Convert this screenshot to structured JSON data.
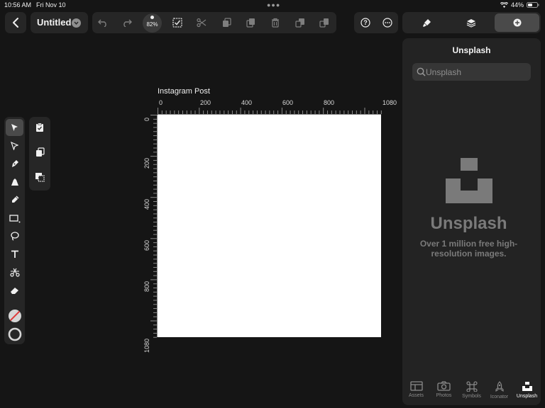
{
  "status_bar": {
    "time": "10:56 AM",
    "date": "Fri Nov 10",
    "battery": "44%"
  },
  "document": {
    "title": "Untitled",
    "zoom": "82%"
  },
  "artboard": {
    "title": "Instagram Post",
    "h_ticks": [
      "0",
      "200",
      "400",
      "600",
      "800",
      "1080"
    ],
    "v_ticks": [
      "0",
      "200",
      "400",
      "600",
      "800",
      "1080"
    ]
  },
  "panel": {
    "title": "Unsplash",
    "search_placeholder": "Unsplash",
    "brand": "Unsplash",
    "tagline": "Over 1 million free high-resolution images."
  },
  "tabs": [
    {
      "label": "Assets",
      "active": false
    },
    {
      "label": "Photos",
      "active": false
    },
    {
      "label": "Symbols",
      "active": false
    },
    {
      "label": "Iconator",
      "active": false
    },
    {
      "label": "Unsplash",
      "active": true
    }
  ],
  "colors": {
    "background": "#151515",
    "panel": "#232323",
    "artboard": "#ffffff",
    "accent": "#f0f0f0"
  }
}
